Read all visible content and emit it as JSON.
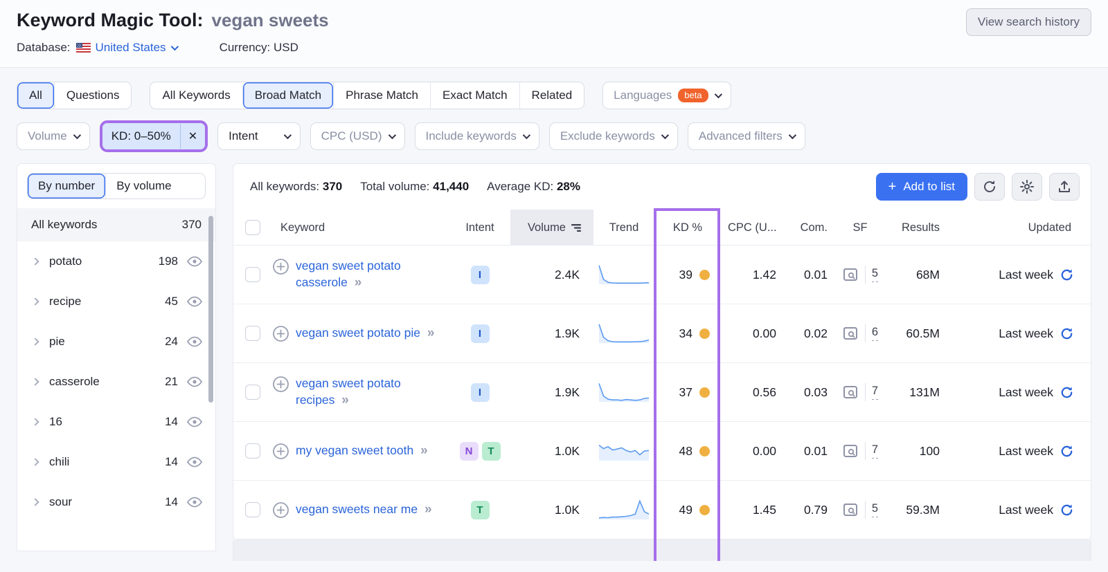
{
  "header": {
    "title": "Keyword Magic Tool:",
    "query": "vegan sweets",
    "database_label": "Database:",
    "database_value": "United States",
    "currency": "Currency: USD",
    "view_history": "View search history"
  },
  "filters": {
    "scope_tabs": [
      {
        "label": "All",
        "selected": true
      },
      {
        "label": "Questions",
        "selected": false
      }
    ],
    "match_tabs": [
      {
        "label": "All Keywords",
        "selected": false
      },
      {
        "label": "Broad Match",
        "selected": true
      },
      {
        "label": "Phrase Match",
        "selected": false
      },
      {
        "label": "Exact Match",
        "selected": false
      },
      {
        "label": "Related",
        "selected": false
      }
    ],
    "languages": {
      "label": "Languages",
      "badge": "beta"
    },
    "volume": "Volume",
    "kd": {
      "label": "KD: 0–50%",
      "close": "✕",
      "highlighted": true
    },
    "intent": "Intent",
    "cpc": "CPC (USD)",
    "include": "Include keywords",
    "exclude": "Exclude keywords",
    "advanced": "Advanced filters"
  },
  "sidebar": {
    "tabs": [
      {
        "label": "By number",
        "selected": true
      },
      {
        "label": "By volume",
        "selected": false
      }
    ],
    "all_row": {
      "label": "All keywords",
      "count": "370"
    },
    "groups": [
      {
        "label": "potato",
        "count": "198"
      },
      {
        "label": "recipe",
        "count": "45"
      },
      {
        "label": "pie",
        "count": "24"
      },
      {
        "label": "casserole",
        "count": "21"
      },
      {
        "label": "16",
        "count": "14"
      },
      {
        "label": "chili",
        "count": "14"
      },
      {
        "label": "sour",
        "count": "14"
      }
    ]
  },
  "summary": {
    "all_label": "All keywords:",
    "all_value": "370",
    "volume_label": "Total volume:",
    "volume_value": "41,440",
    "kd_label": "Average KD:",
    "kd_value": "28%",
    "add_plus": "+",
    "add_to_list": "Add to list"
  },
  "table": {
    "columns": [
      "Keyword",
      "Intent",
      "Volume",
      "Trend",
      "KD %",
      "CPC (U...",
      "Com.",
      "SF",
      "Results",
      "Updated"
    ],
    "expand_icon": "»",
    "rows": [
      {
        "keyword": "vegan sweet potato casserole",
        "intents": [
          {
            "label": "I",
            "kind": "informational"
          }
        ],
        "volume": "2.4K",
        "kd": "39",
        "cpc": "1.42",
        "com": "0.01",
        "sf": "5",
        "results": "68M",
        "updated": "Last week",
        "trend": [
          0.97,
          0.25,
          0.1,
          0.07,
          0.06,
          0.06,
          0.06,
          0.06,
          0.06,
          0.06,
          0.07,
          0.08
        ]
      },
      {
        "keyword": "vegan sweet potato pie",
        "intents": [
          {
            "label": "I",
            "kind": "informational"
          }
        ],
        "volume": "1.9K",
        "kd": "34",
        "cpc": "0.00",
        "com": "0.02",
        "sf": "6",
        "results": "60.5M",
        "updated": "Last week",
        "trend": [
          0.97,
          0.3,
          0.12,
          0.07,
          0.06,
          0.06,
          0.06,
          0.06,
          0.07,
          0.08,
          0.1,
          0.16
        ]
      },
      {
        "keyword": "vegan sweet potato recipes",
        "intents": [
          {
            "label": "I",
            "kind": "informational"
          }
        ],
        "volume": "1.9K",
        "kd": "37",
        "cpc": "0.56",
        "com": "0.03",
        "sf": "7",
        "results": "131M",
        "updated": "Last week",
        "trend": [
          0.95,
          0.3,
          0.14,
          0.1,
          0.1,
          0.08,
          0.12,
          0.1,
          0.08,
          0.1,
          0.18,
          0.2
        ]
      },
      {
        "keyword": "my vegan sweet tooth",
        "intents": [
          {
            "label": "N",
            "kind": "navigational"
          },
          {
            "label": "T",
            "kind": "transactional"
          }
        ],
        "volume": "1.0K",
        "kd": "48",
        "cpc": "0.00",
        "com": "0.01",
        "sf": "7",
        "results": "100",
        "updated": "Last week",
        "trend": [
          0.8,
          0.62,
          0.72,
          0.55,
          0.6,
          0.66,
          0.52,
          0.45,
          0.52,
          0.3,
          0.5,
          0.52
        ]
      },
      {
        "keyword": "vegan sweets near me",
        "intents": [
          {
            "label": "T",
            "kind": "transactional"
          }
        ],
        "volume": "1.0K",
        "kd": "49",
        "cpc": "1.45",
        "com": "0.79",
        "sf": "5",
        "results": "59.3M",
        "updated": "Last week",
        "trend": [
          0.08,
          0.1,
          0.09,
          0.12,
          0.12,
          0.14,
          0.16,
          0.2,
          0.28,
          0.95,
          0.4,
          0.28
        ]
      }
    ]
  },
  "colors": {
    "accent_blue": "#3971f1",
    "link_blue": "#2a64d9",
    "highlight_purple": "#a56fea",
    "kd_dot_orange": "#efb041",
    "beta_orange": "#f0632c",
    "intent_i": "#cfe3fc",
    "intent_n": "#e9dcfa",
    "intent_t": "#b9ecd0",
    "sparkline_blue": "#5b9bf0"
  }
}
